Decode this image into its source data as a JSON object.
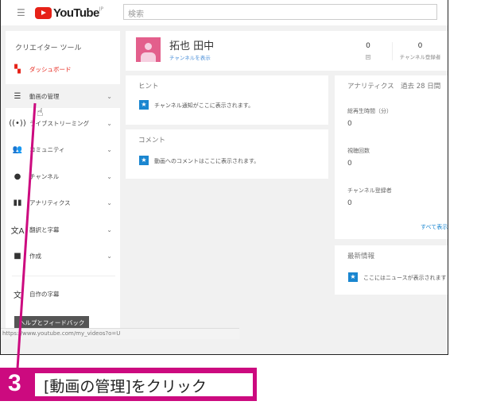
{
  "header": {
    "logo": "YouTube",
    "region": "JP",
    "search_placeholder": "検索"
  },
  "sidebar": {
    "title": "クリエイター ツール",
    "items": [
      {
        "label": "ダッシュボード",
        "icon": "dashboard-icon"
      },
      {
        "label": "動画の管理",
        "icon": "video-manager-icon"
      },
      {
        "label": "ライブストリーミング",
        "icon": "live-icon"
      },
      {
        "label": "コミュニティ",
        "icon": "community-icon"
      },
      {
        "label": "チャンネル",
        "icon": "channel-icon"
      },
      {
        "label": "アナリティクス",
        "icon": "analytics-icon"
      },
      {
        "label": "翻訳と字幕",
        "icon": "translate-icon"
      },
      {
        "label": "作成",
        "icon": "create-icon"
      }
    ],
    "subtitles": "自作の字幕",
    "help": "ヘルプとフィードバック"
  },
  "status_url": "https://www.youtube.com/my_videos?o=U",
  "channel": {
    "name": "拓也 田中",
    "link": "チャンネルを表示",
    "views_value": "0",
    "views_label": "回",
    "subs_value": "0",
    "subs_label": "チャンネル登録者"
  },
  "hints": {
    "title": "ヒント",
    "text": "チャンネル通知がここに表示されます。"
  },
  "comments": {
    "title": "コメント",
    "text": "動画へのコメントはここに表示されます。"
  },
  "analytics": {
    "title": "アナリティクス　過去 28 日間",
    "metrics": [
      {
        "label": "総再生時間（分）",
        "value": "0"
      },
      {
        "label": "視聴回数",
        "value": "0"
      },
      {
        "label": "チャンネル登録者",
        "value": "0"
      }
    ],
    "more": "すべて表示"
  },
  "news": {
    "title": "最新情報",
    "text": "ここにはニュースが表示されます"
  },
  "caption": {
    "step": "3",
    "text": "[動画の管理]をクリック"
  },
  "colors": {
    "accent": "#cc0a7f",
    "brand": "#e62117",
    "link": "#1a86d0"
  }
}
